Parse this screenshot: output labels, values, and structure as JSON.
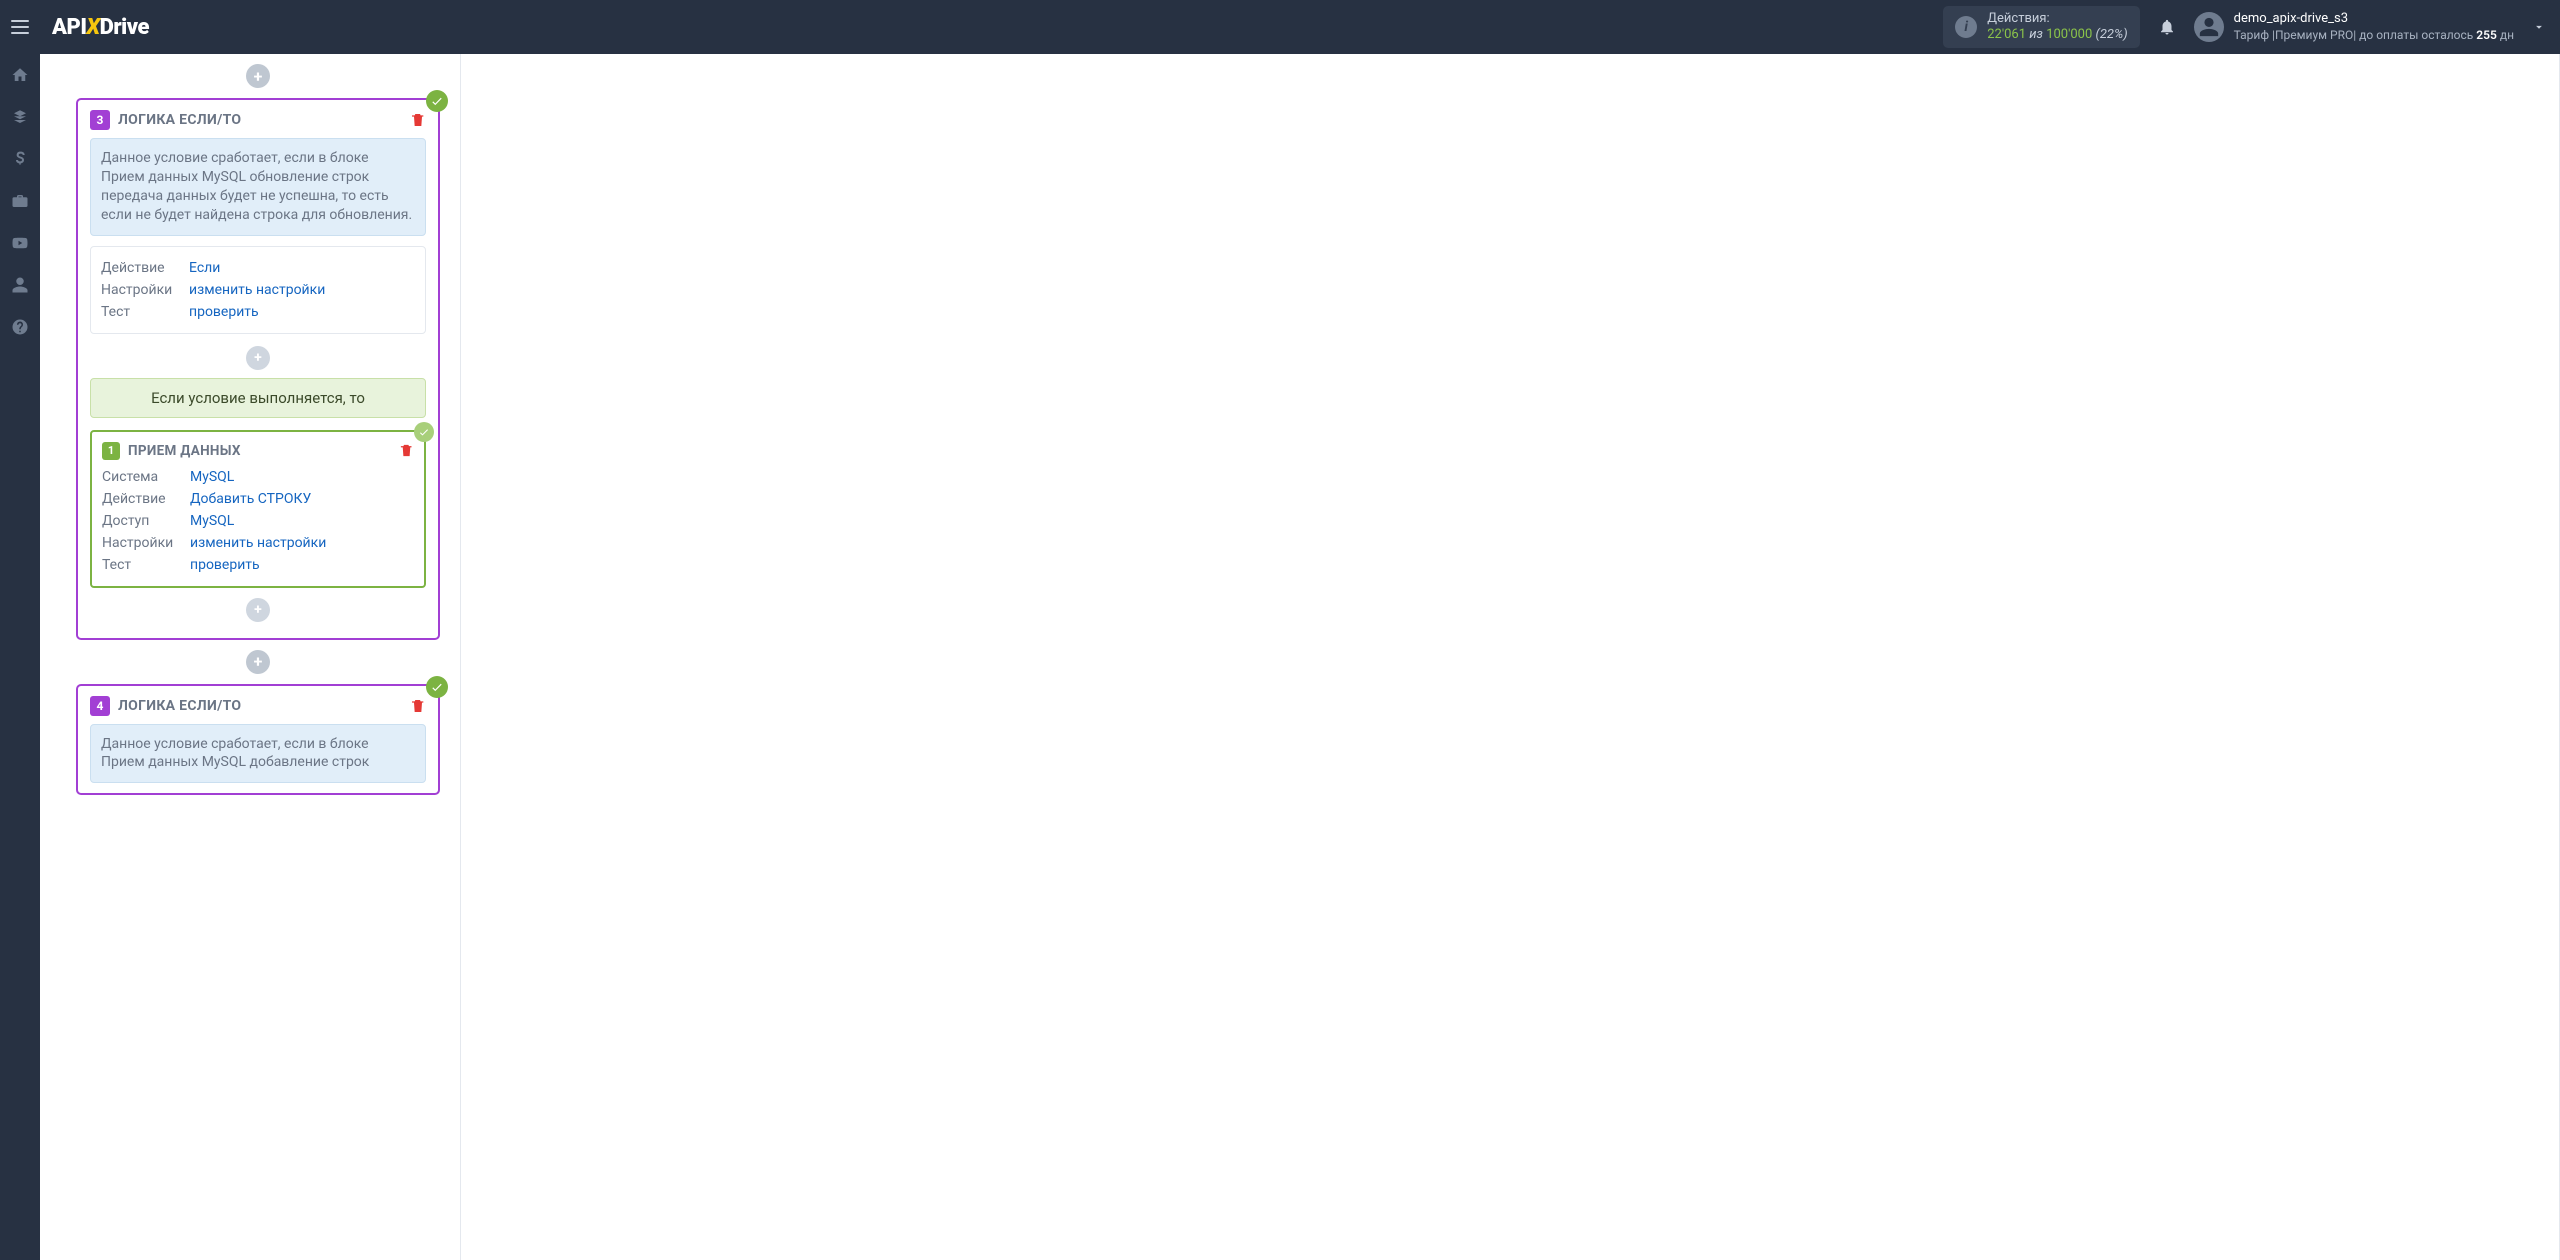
{
  "header": {
    "logo_pre": "API",
    "logo_x": "X",
    "logo_post": "Drive",
    "actions_label": "Действия:",
    "actions_count": "22'061",
    "actions_sep": "из",
    "actions_max": "100'000",
    "actions_pct": "(22%)",
    "username": "demo_apix-drive_s3",
    "tariff_pre": "Тариф |Премиум PRO| до оплаты осталось ",
    "tariff_days": "255",
    "tariff_post": " дн"
  },
  "sidebar_icons": [
    "home",
    "org",
    "money",
    "briefcase",
    "youtube",
    "user",
    "help"
  ],
  "block3": {
    "num": "3",
    "title": "ЛОГИКА ЕСЛИ/ТО",
    "info": "Данное условие сработает, если в блоке Прием данных MySQL обновление строк передача данных будет не успешна, то есть если не будет найдена строка для обновления.",
    "row_action_lbl": "Действие",
    "row_action_val": "Если",
    "row_settings_lbl": "Настройки",
    "row_settings_val": "изменить настройки",
    "row_test_lbl": "Тест",
    "row_test_val": "проверить",
    "iftrue": "Если условие выполняется, то"
  },
  "sub1": {
    "num": "1",
    "title": "ПРИЕМ ДАННЫХ",
    "row_system_lbl": "Система",
    "row_system_val": "MySQL",
    "row_action_lbl": "Действие",
    "row_action_val": "Добавить СТРОКУ",
    "row_access_lbl": "Доступ",
    "row_access_val": "MySQL",
    "row_settings_lbl": "Настройки",
    "row_settings_val": "изменить настройки",
    "row_test_lbl": "Тест",
    "row_test_val": "проверить"
  },
  "block4": {
    "num": "4",
    "title": "ЛОГИКА ЕСЛИ/ТО",
    "info": "Данное условие сработает, если в блоке Прием данных MySQL добавление строк"
  }
}
